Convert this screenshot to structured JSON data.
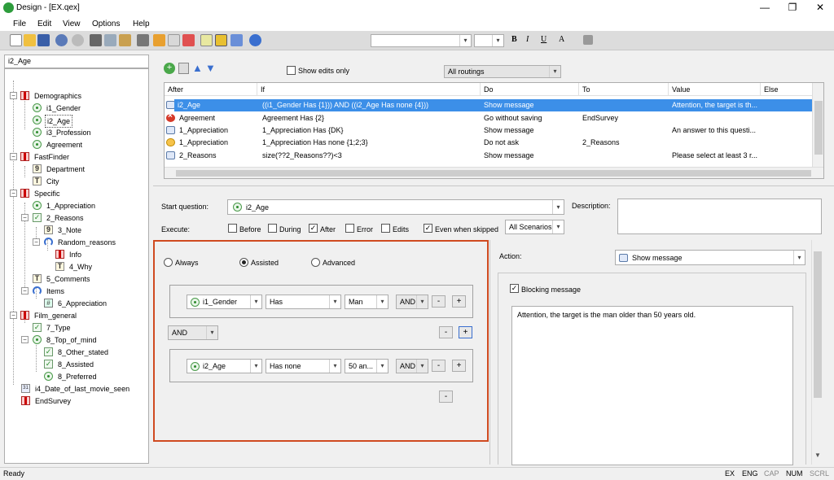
{
  "window": {
    "title": "Design - [EX.qex]",
    "minimize": "—",
    "restore": "❐",
    "close": "✕"
  },
  "menu": [
    "File",
    "Edit",
    "View",
    "Options",
    "Help"
  ],
  "left": {
    "search_value": "i2_Age"
  },
  "tree": [
    {
      "label": "Demographics",
      "icon": "book",
      "level": 0
    },
    {
      "label": "i1_Gender",
      "icon": "radio",
      "level": 1
    },
    {
      "label": "i2_Age",
      "icon": "radio",
      "level": 1,
      "selected": true
    },
    {
      "label": "i3_Profession",
      "icon": "radio",
      "level": 1
    },
    {
      "label": "Agreement",
      "icon": "radio",
      "level": 1
    },
    {
      "label": "FastFinder",
      "icon": "book",
      "level": 0
    },
    {
      "label": "Department",
      "icon": "text",
      "level": 1
    },
    {
      "label": "City",
      "icon": "text",
      "level": 1
    },
    {
      "label": "Specific",
      "icon": "book",
      "level": 0
    },
    {
      "label": "1_Appreciation",
      "icon": "radio",
      "level": 1
    },
    {
      "label": "2_Reasons",
      "icon": "check",
      "level": 1
    },
    {
      "label": "3_Note",
      "icon": "text",
      "level": 2
    },
    {
      "label": "Random_reasons",
      "icon": "loop",
      "level": 2
    },
    {
      "label": "Info",
      "icon": "book",
      "level": 3
    },
    {
      "label": "4_Why",
      "icon": "text",
      "level": 3
    },
    {
      "label": "5_Comments",
      "icon": "text",
      "level": 1
    },
    {
      "label": "Items",
      "icon": "loop",
      "level": 1
    },
    {
      "label": "6_Appreciation",
      "icon": "grid",
      "level": 2
    },
    {
      "label": "Film_general",
      "icon": "book",
      "level": 0
    },
    {
      "label": "7_Type",
      "icon": "check",
      "level": 1
    },
    {
      "label": "8_Top_of_mind",
      "icon": "radio",
      "level": 1
    },
    {
      "label": "8_Other_stated",
      "icon": "check",
      "level": 2
    },
    {
      "label": "8_Assisted",
      "icon": "check",
      "level": 2
    },
    {
      "label": "8_Preferred",
      "icon": "radio",
      "level": 2
    },
    {
      "label": "i4_Date_of_last_movie_seen",
      "icon": "date",
      "level": 0
    },
    {
      "label": "EndSurvey",
      "icon": "book",
      "level": 0
    }
  ],
  "routing": {
    "show_edits_only": "Show edits only",
    "routings_value": "All routings",
    "columns": [
      "After",
      "If",
      "Do",
      "To",
      "Value",
      "Else"
    ],
    "rows": [
      {
        "after": "i2_Age",
        "icon": "msg",
        "if": "((i1_Gender Has {1})) AND ((i2_Age Has none {4}))",
        "do": "Show message",
        "to": "",
        "value": "Attention, the target is th...",
        "selected": true
      },
      {
        "after": "Agreement",
        "icon": "err",
        "if": "Agreement Has {2}",
        "do": "Go without saving",
        "to": "EndSurvey",
        "value": ""
      },
      {
        "after": "1_Appreciation",
        "icon": "msg",
        "if": "1_Appreciation Has {DK}",
        "do": "Show message",
        "to": "",
        "value": "An answer to this questi..."
      },
      {
        "after": "1_Appreciation",
        "icon": "ask",
        "if": "1_Appreciation Has none {1;2;3}",
        "do": "Do not ask",
        "to": "2_Reasons",
        "value": ""
      },
      {
        "after": "2_Reasons",
        "icon": "msg",
        "if": "size(??2_Reasons??)<3",
        "do": "Show message",
        "to": "",
        "value": "Please select at least 3 r..."
      }
    ]
  },
  "editor": {
    "start_question_label": "Start question:",
    "start_question_value": "i2_Age",
    "description_label": "Description:",
    "execute_label": "Execute:",
    "execute": [
      {
        "label": "Before",
        "checked": false
      },
      {
        "label": "During",
        "checked": false
      },
      {
        "label": "After",
        "checked": true
      },
      {
        "label": "Error",
        "checked": false
      },
      {
        "label": "Edits",
        "checked": false
      },
      {
        "label": "Even when skipped",
        "checked": true
      }
    ],
    "scenarios_value": "All Scenarios",
    "mode": {
      "always": "Always",
      "assisted": "Assisted",
      "advanced": "Advanced",
      "selected": "assisted"
    },
    "conditions": [
      {
        "question": "i1_Gender",
        "operator": "Has",
        "value": "Man",
        "join": "AND"
      },
      {
        "question": "i2_Age",
        "operator": "Has none",
        "value": "50 an...",
        "join": "AND"
      }
    ],
    "group_join": "AND",
    "minus": "-",
    "plus": "+",
    "action_label": "Action:",
    "action_value": "Show message",
    "blocking_label": "Blocking message",
    "message_text": "Attention, the target is the man older than 50 years old."
  },
  "status": {
    "left": "Ready",
    "items": [
      "EX",
      "ENG",
      "CAP",
      "NUM",
      "SCRL"
    ]
  },
  "colors": {
    "selection": "#3c8fe8",
    "highlight_border": "#d04a20"
  }
}
